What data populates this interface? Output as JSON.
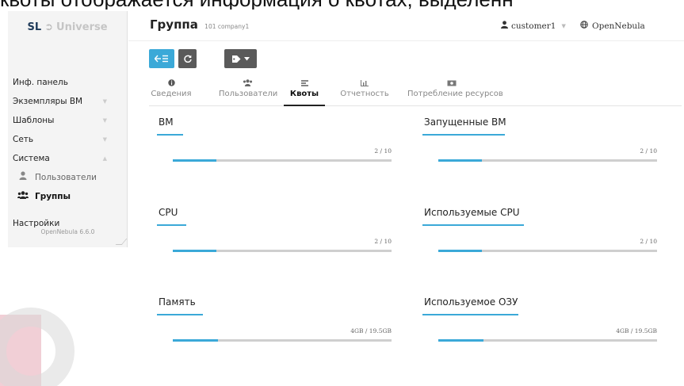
{
  "caption": {
    "text": "квоты отображается информация о квотах, выделенн"
  },
  "sidebar": {
    "logo_sl": "SL",
    "logo_name": "Universe",
    "items": [
      {
        "label": "Инф. панель"
      },
      {
        "label": "Экземпляры ВМ"
      },
      {
        "label": "Шаблоны"
      },
      {
        "label": "Сеть"
      },
      {
        "label": "Система"
      }
    ],
    "sub_items": [
      {
        "label": "Пользователи",
        "icon": "user-icon"
      },
      {
        "label": "Группы",
        "icon": "group-icon"
      }
    ],
    "settings_label": "Настройки",
    "version": "OpenNebula 6.6.0"
  },
  "header": {
    "title": "Группа",
    "subtitle": "101 company1",
    "user": "customer1",
    "zone": "OpenNebula"
  },
  "tabs": [
    {
      "label": "Сведения",
      "icon": "info-icon"
    },
    {
      "label": "Пользователи",
      "icon": "users-icon"
    },
    {
      "label": "Квоты",
      "icon": "align-left-icon"
    },
    {
      "label": "Отчетность",
      "icon": "bar-chart-icon"
    },
    {
      "label": "Потребление ресурсов",
      "icon": "money-icon"
    }
  ],
  "active_tab": "Квоты",
  "quotas": [
    {
      "title": "ВМ",
      "value": "2 / 10",
      "fraction": 0.2
    },
    {
      "title": "Запущенные ВМ",
      "value": "2 / 10",
      "fraction": 0.2
    },
    {
      "title": "CPU",
      "value": "2 / 10",
      "fraction": 0.2
    },
    {
      "title": "Используемые CPU",
      "value": "2 / 10",
      "fraction": 0.2
    },
    {
      "title": "Память",
      "value": "4GB / 19.5GB",
      "fraction": 0.205
    },
    {
      "title": "Используемое ОЗУ",
      "value": "4GB / 19.5GB",
      "fraction": 0.205
    }
  ],
  "colors": {
    "accent": "#3ba9d8",
    "dark_button": "#5a5a5a",
    "track": "#cfcfcf"
  }
}
